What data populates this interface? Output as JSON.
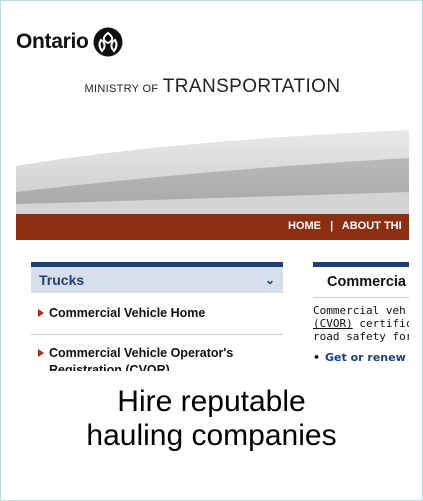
{
  "header": {
    "logo_text": "Ontario",
    "logo_icon": "ontario-trillium-icon",
    "ministry_small": "MINISTRY OF",
    "ministry_big": "TRANSPORTATION"
  },
  "nav": {
    "home": "HOME",
    "separator": "|",
    "about": "ABOUT THI"
  },
  "sidebar": {
    "title": "Trucks",
    "items": [
      {
        "label": "Commercial Vehicle Home"
      },
      {
        "label": "Commercial Vehicle Operator's Registration (CVOR)"
      }
    ]
  },
  "content": {
    "title": "Commercia",
    "lines": [
      "Commercial veh",
      "certifica",
      "road safety for a"
    ],
    "cvor_link": "(CVOR)",
    "bullet": "Get or renew"
  },
  "caption": {
    "line1": "Hire reputable",
    "line2": "hauling companies"
  },
  "colors": {
    "nav_bar": "#8c2e12",
    "sidebar_header": "#d6dfea",
    "accent_blue": "#1d3f7a",
    "frame_border": "#b5dde3"
  }
}
